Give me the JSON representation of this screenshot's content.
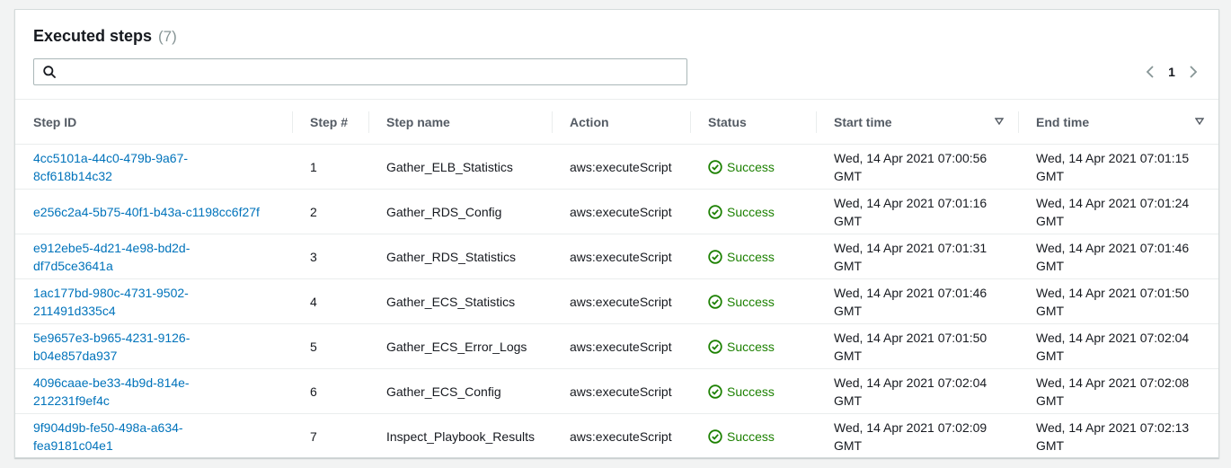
{
  "header": {
    "title": "Executed steps",
    "count": "(7)",
    "search_placeholder": ""
  },
  "pagination": {
    "current_page": "1"
  },
  "columns": {
    "step_id": "Step ID",
    "step_num": "Step #",
    "step_name": "Step name",
    "action": "Action",
    "status": "Status",
    "start_time": "Start time",
    "end_time": "End time"
  },
  "rows": [
    {
      "id_line1": "4cc5101a-44c0-479b-9a67-",
      "id_line2": "8cf618b14c32",
      "num": "1",
      "name": "Gather_ELB_Statistics",
      "action": "aws:executeScript",
      "status": "Success",
      "start1": "Wed, 14 Apr 2021 07:00:56",
      "start2": "GMT",
      "end1": "Wed, 14 Apr 2021 07:01:15",
      "end2": "GMT"
    },
    {
      "id_line1": "e256c2a4-5b75-40f1-b43a-c1198cc6f27f",
      "id_line2": "",
      "num": "2",
      "name": "Gather_RDS_Config",
      "action": "aws:executeScript",
      "status": "Success",
      "start1": "Wed, 14 Apr 2021 07:01:16",
      "start2": "GMT",
      "end1": "Wed, 14 Apr 2021 07:01:24",
      "end2": "GMT"
    },
    {
      "id_line1": "e912ebe5-4d21-4e98-bd2d-",
      "id_line2": "df7d5ce3641a",
      "num": "3",
      "name": "Gather_RDS_Statistics",
      "action": "aws:executeScript",
      "status": "Success",
      "start1": "Wed, 14 Apr 2021 07:01:31",
      "start2": "GMT",
      "end1": "Wed, 14 Apr 2021 07:01:46",
      "end2": "GMT"
    },
    {
      "id_line1": "1ac177bd-980c-4731-9502-",
      "id_line2": "211491d335c4",
      "num": "4",
      "name": "Gather_ECS_Statistics",
      "action": "aws:executeScript",
      "status": "Success",
      "start1": "Wed, 14 Apr 2021 07:01:46",
      "start2": "GMT",
      "end1": "Wed, 14 Apr 2021 07:01:50",
      "end2": "GMT"
    },
    {
      "id_line1": "5e9657e3-b965-4231-9126-",
      "id_line2": "b04e857da937",
      "num": "5",
      "name": "Gather_ECS_Error_Logs",
      "action": "aws:executeScript",
      "status": "Success",
      "start1": "Wed, 14 Apr 2021 07:01:50",
      "start2": "GMT",
      "end1": "Wed, 14 Apr 2021 07:02:04",
      "end2": "GMT"
    },
    {
      "id_line1": "4096caae-be33-4b9d-814e-",
      "id_line2": "212231f9ef4c",
      "num": "6",
      "name": "Gather_ECS_Config",
      "action": "aws:executeScript",
      "status": "Success",
      "start1": "Wed, 14 Apr 2021 07:02:04",
      "start2": "GMT",
      "end1": "Wed, 14 Apr 2021 07:02:08",
      "end2": "GMT"
    },
    {
      "id_line1": "9f904d9b-fe50-498a-a634-",
      "id_line2": "fea9181c04e1",
      "num": "7",
      "name": "Inspect_Playbook_Results",
      "action": "aws:executeScript",
      "status": "Success",
      "start1": "Wed, 14 Apr 2021 07:02:09",
      "start2": "GMT",
      "end1": "Wed, 14 Apr 2021 07:02:13",
      "end2": "GMT"
    }
  ],
  "icons": {
    "search": "search-icon",
    "prev": "chevron-left-icon",
    "next": "chevron-right-icon",
    "sort": "sort-down-icon",
    "status": "check-circle-icon"
  },
  "colors": {
    "link": "#0073bb",
    "success": "#1d8102",
    "muted": "#879596"
  }
}
